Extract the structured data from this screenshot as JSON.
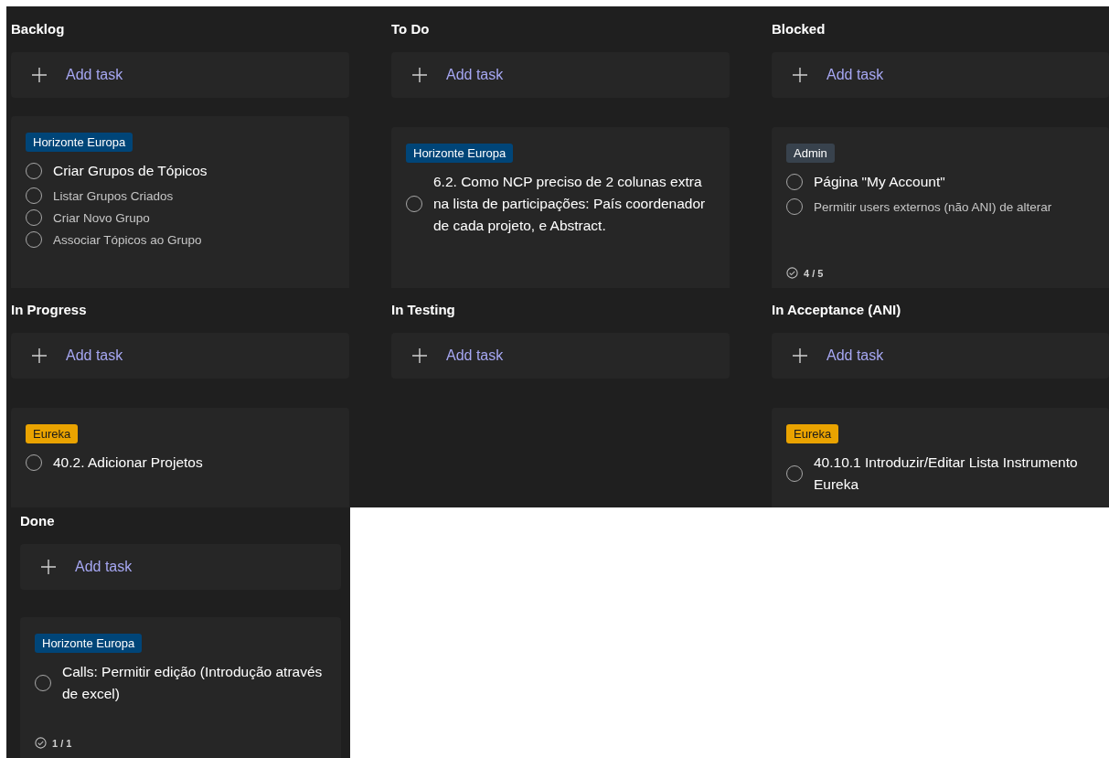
{
  "board": {
    "columns": [
      {
        "title": "Backlog",
        "add_label": "Add task",
        "card": {
          "label": {
            "text": "Horizonte Europa",
            "color": "#004578"
          },
          "title": "Criar Grupos de Tópicos",
          "completed": false,
          "checklist": [
            {
              "text": "Listar Grupos Criados",
              "checked": false
            },
            {
              "text": "Criar Novo Grupo",
              "checked": false
            },
            {
              "text": "Associar Tópicos ao Grupo",
              "checked": false
            }
          ]
        }
      },
      {
        "title": "To Do",
        "add_label": "Add task",
        "card": {
          "label": {
            "text": "Horizonte Europa",
            "color": "#004578"
          },
          "title": "6.2. Como NCP preciso de 2 colunas extra na lista de participações: País coordenador de cada projeto, e Abstract.",
          "completed": false
        }
      },
      {
        "title": "Blocked",
        "add_label": "Add task",
        "card": {
          "label": {
            "text": "Admin",
            "color": "#38424d"
          },
          "title": "Página \"My Account\"",
          "completed": false,
          "checklist": [
            {
              "text": "Permitir users externos (não ANI) de alterar",
              "checked": false
            }
          ],
          "progress": "4 / 5"
        }
      },
      {
        "title": "In Progress",
        "add_label": "Add task",
        "card": {
          "label": {
            "text": "Eureka",
            "color": "#eaa300"
          },
          "title": "40.2. Adicionar Projetos",
          "completed": false
        }
      },
      {
        "title": "In Testing",
        "add_label": "Add task"
      },
      {
        "title": "In Acceptance (ANI)",
        "add_label": "Add task",
        "card": {
          "label": {
            "text": "Eureka",
            "color": "#eaa300"
          },
          "title": "40.10.1 Introduzir/Editar Lista Instrumento Eureka",
          "completed": false
        }
      }
    ]
  },
  "done_column": {
    "title": "Done",
    "add_label": "Add task",
    "card": {
      "label": {
        "text": "Horizonte Europa",
        "color": "#004578"
      },
      "title": "Calls: Permitir edição (Introdução através de excel)",
      "completed": false,
      "progress": "1 / 1"
    }
  }
}
